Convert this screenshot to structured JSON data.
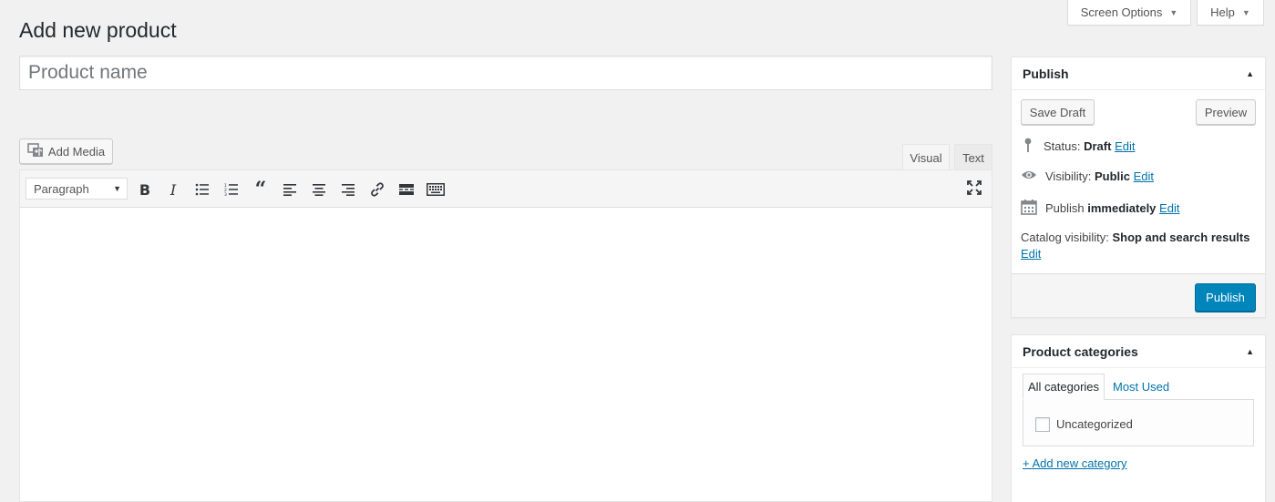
{
  "header": {
    "page_title": "Add new product",
    "screen_options_label": "Screen Options",
    "help_label": "Help"
  },
  "product": {
    "name_placeholder": "Product name"
  },
  "editor": {
    "add_media_label": "Add Media",
    "tab_visual": "Visual",
    "tab_text": "Text",
    "format_select_value": "Paragraph",
    "toolbar_icons": [
      "bold-icon",
      "italic-icon",
      "bullet-list-icon",
      "numbered-list-icon",
      "blockquote-icon",
      "align-left-icon",
      "align-center-icon",
      "align-right-icon",
      "link-icon",
      "read-more-icon",
      "toolbar-toggle-icon",
      "fullscreen-icon"
    ]
  },
  "publish": {
    "title": "Publish",
    "save_draft_label": "Save Draft",
    "preview_label": "Preview",
    "status_label": "Status:",
    "status_value": "Draft",
    "visibility_label": "Visibility:",
    "visibility_value": "Public",
    "publish_label": "Publish",
    "publish_value": "immediately",
    "catalog_label": "Catalog visibility:",
    "catalog_value": "Shop and search results",
    "edit_label": "Edit",
    "publish_button_label": "Publish"
  },
  "categories": {
    "title": "Product categories",
    "tab_all": "All categories",
    "tab_most_used": "Most Used",
    "items": [
      {
        "label": "Uncategorized",
        "checked": false
      }
    ],
    "add_new_label": "+ Add new category"
  },
  "colors": {
    "accent": "#0073aa",
    "primary_button": "#0085ba",
    "background": "#f1f1f1"
  }
}
